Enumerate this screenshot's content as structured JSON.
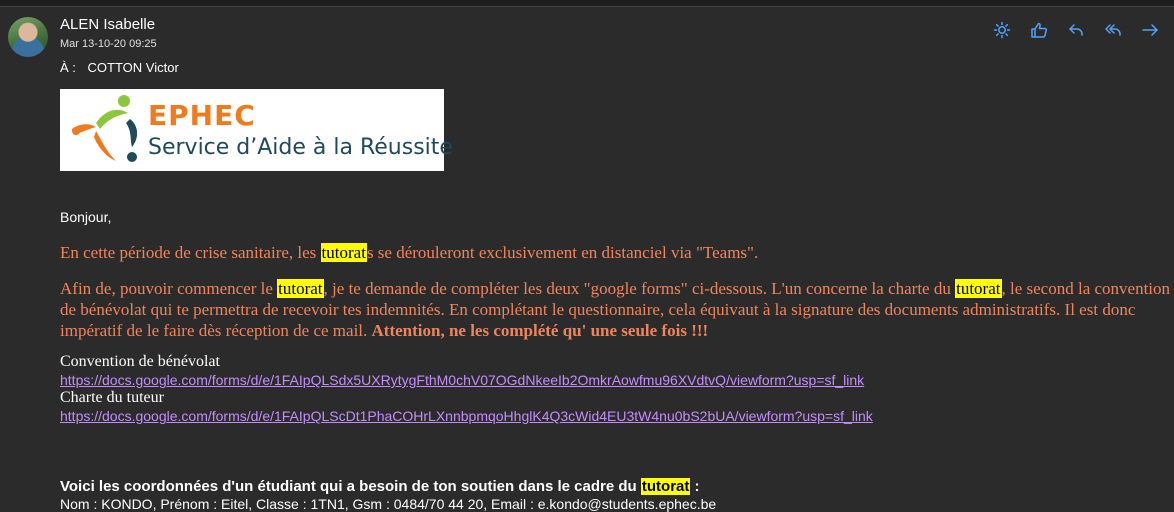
{
  "message": {
    "sender": "ALEN Isabelle",
    "date": "Mar 13-10-20 09:25",
    "to_label": "À :",
    "to": "COTTON Victor"
  },
  "actions": [
    {
      "name": "sun-icon"
    },
    {
      "name": "like-icon"
    },
    {
      "name": "reply-icon"
    },
    {
      "name": "reply-all-icon"
    },
    {
      "name": "forward-icon"
    }
  ],
  "logo": {
    "brand": "EPHEC",
    "tagline": "Service d’Aide à la Réussite"
  },
  "content": {
    "greeting": "Bonjour,",
    "p1_a": "En cette période de crise sanitaire, les ",
    "p1_mark": "tutorat",
    "p1_b": "s se dérouleront exclusivement en distanciel via \"Teams\".",
    "p2_l1_a": "Afin de, pouvoir commencer le ",
    "p2_l1_mark1": "tutorat",
    "p2_l1_b": ", je te demande de compléter les deux \"google forms\" ci-dessous. L'un concerne la charte du ",
    "p2_l1_mark2": "tutorat",
    "p2_l1_c": ", le second la convention",
    "p2_l2": "de bénévolat qui te permettra de recevoir tes indemnités. En complétant le questionnaire, cela équivaut à la signature des documents administratifs. Il est donc",
    "p2_l3_a": "impératif de le faire dès réception de ce mail. ",
    "p2_l3_bold": "Attention, ne les complété qu' une seule fois !!!",
    "conv_label": "Convention de bénévolat",
    "conv_link": "https://docs.google.com/forms/d/e/1FAIpQLSdx5UXRytygFthM0chV07OGdNkeeIb2OmkrAowfmu96XVdtvQ/viewform?usp=sf_link",
    "charte_label": "Charte du tuteur",
    "charte_link": "https://docs.google.com/forms/d/e/1FAIpQLScDt1PhaCOHrLXnnbpmqoHhglK4Q3cWid4EU3tW4nu0bS2bUA/viewform?usp=sf_link",
    "footer_a": "Voici les coordonnées d'un étudiant qui a besoin de ton soutien dans le cadre du ",
    "footer_mark": "tutorat",
    "footer_b": " :",
    "next_line": "Nom : KONDO, Prénom : Eitel, Classe : 1TN1, Gsm : 0484/70 44 20, Email : e.kondo@students.ephec.be"
  }
}
